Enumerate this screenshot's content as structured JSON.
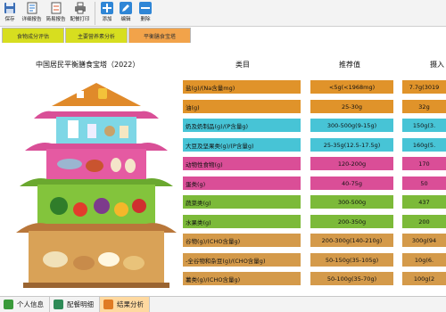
{
  "toolbar": {
    "save": "保存",
    "detail_report": "详细报告",
    "simple_report": "简易报告",
    "meal_print": "配餐打印",
    "add": "添加",
    "edit": "编辑",
    "delete": "删除"
  },
  "module_tabs": [
    "食物成分评估",
    "主要营养素分析",
    "平衡膳食宝塔"
  ],
  "pyramid_title": "中国居民平衡膳食宝塔（2022）",
  "table": {
    "headers": [
      "类目",
      "推荐值",
      "摄入"
    ],
    "rows": [
      {
        "label": "盐(g)/(Na含量mg)",
        "rec": "<5g(<1968mg)",
        "intake": "7.7g(3019",
        "color": "#e0932a"
      },
      {
        "label": "油(g)",
        "rec": "25-30g",
        "intake": "32g",
        "color": "#e0932a"
      },
      {
        "label": "奶及奶制品(g)/(P含量g)",
        "rec": "300-500g(9-15g)",
        "intake": "150g(3.",
        "color": "#47c4d6"
      },
      {
        "label": "大豆及坚果类(g)/(P含量g)",
        "rec": "25-35g(12.5-17.5g)",
        "intake": "160g(5.",
        "color": "#47c4d6"
      },
      {
        "label": "动物性食物(g)",
        "rec": "120-200g",
        "intake": "170",
        "color": "#da4e97"
      },
      {
        "label": "蛋类(g)",
        "rec": "40-75g",
        "intake": "50",
        "color": "#da4e97"
      },
      {
        "label": "蔬菜类(g)",
        "rec": "300-500g",
        "intake": "437",
        "color": "#7cba39"
      },
      {
        "label": "水果类(g)",
        "rec": "200-350g",
        "intake": "200",
        "color": "#7cba39"
      },
      {
        "label": "谷物(g)/(CHO含量g)",
        "rec": "200-300g(140-210g)",
        "intake": "300g(94",
        "color": "#d49a4a"
      },
      {
        "label": "-全谷物和杂豆(g)/(CHO含量g)",
        "rec": "50-150g(35-105g)",
        "intake": "10g(6.",
        "color": "#d49a4a"
      },
      {
        "label": "薯类(g)/(CHO含量g)",
        "rec": "50-100g(35-70g)",
        "intake": "100g(2",
        "color": "#d49a4a"
      }
    ]
  },
  "bottom_tabs": [
    {
      "label": "个人信息",
      "icon": "person-icon",
      "color": "#3a9a3a"
    },
    {
      "label": "配餐明细",
      "icon": "detail-icon",
      "color": "#2e8b57"
    },
    {
      "label": "结果分析",
      "icon": "analysis-icon",
      "color": "#e07b24"
    }
  ]
}
